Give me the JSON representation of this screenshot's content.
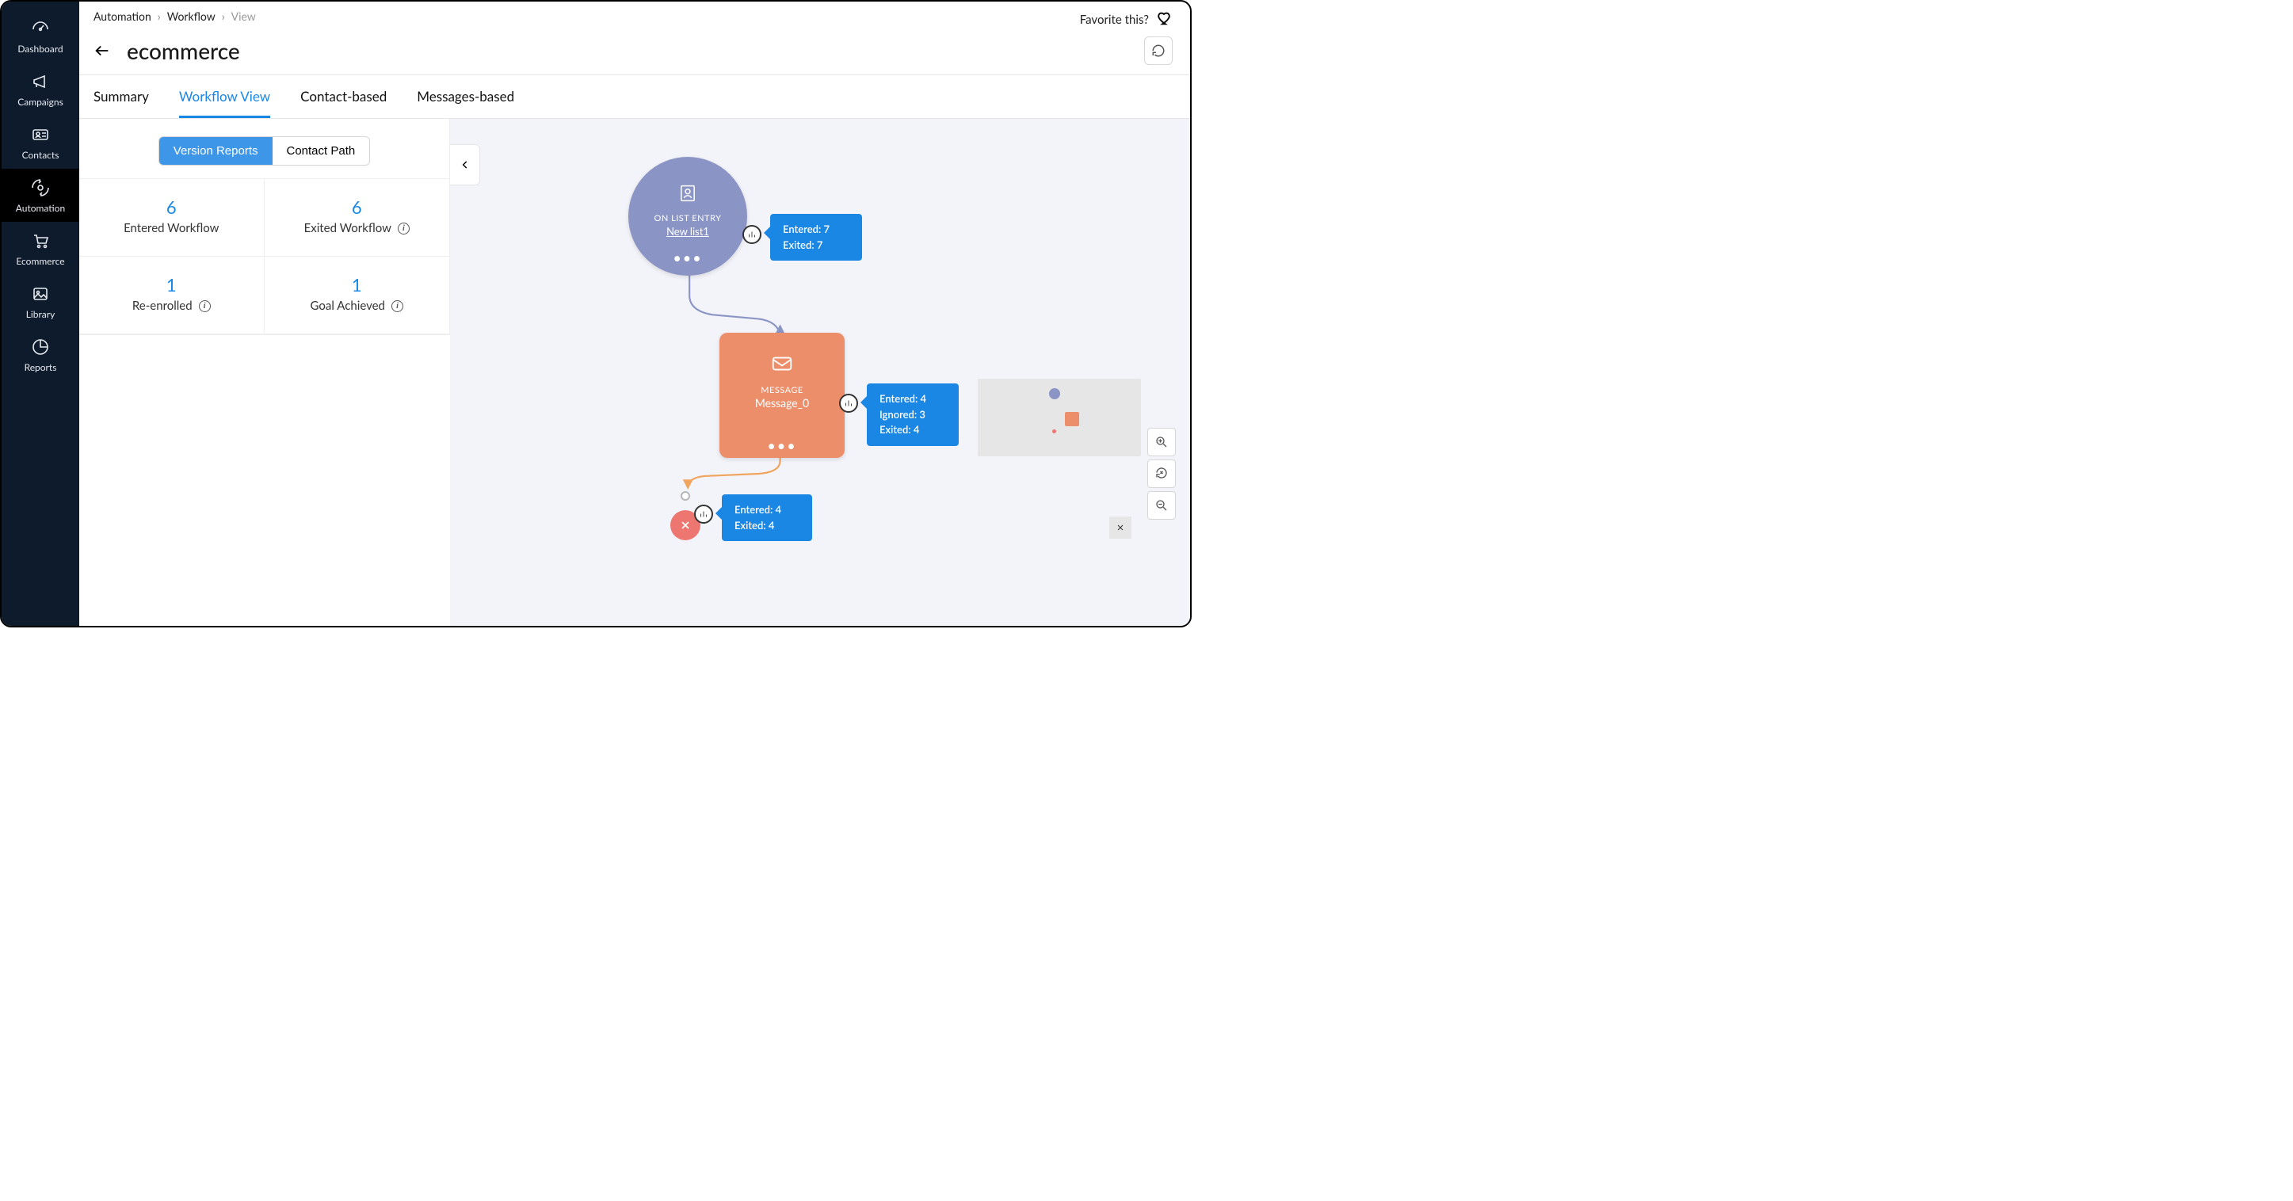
{
  "sidebar": {
    "items": [
      {
        "label": "Dashboard"
      },
      {
        "label": "Campaigns"
      },
      {
        "label": "Contacts"
      },
      {
        "label": "Automation"
      },
      {
        "label": "Ecommerce"
      },
      {
        "label": "Library"
      },
      {
        "label": "Reports"
      }
    ]
  },
  "breadcrumb": {
    "items": [
      "Automation",
      "Workflow",
      "View"
    ]
  },
  "header": {
    "favorite_label": "Favorite this?",
    "page_title": "ecommerce"
  },
  "tabs": [
    {
      "label": "Summary"
    },
    {
      "label": "Workflow View"
    },
    {
      "label": "Contact-based"
    },
    {
      "label": "Messages-based"
    }
  ],
  "panel": {
    "toggle": {
      "a": "Version Reports",
      "b": "Contact Path"
    },
    "stats": [
      {
        "value": "6",
        "label": "Entered Workflow",
        "info": false
      },
      {
        "value": "6",
        "label": "Exited Workflow",
        "info": true
      },
      {
        "value": "1",
        "label": "Re-enrolled",
        "info": true
      },
      {
        "value": "1",
        "label": "Goal Achieved",
        "info": true
      }
    ]
  },
  "flow": {
    "trigger": {
      "type_label": "ON LIST ENTRY",
      "name": "New list1",
      "stats": {
        "entered": "Entered: 7",
        "exited": "Exited: 7"
      }
    },
    "message": {
      "type_label": "MESSAGE",
      "name": "Message_0",
      "stats": {
        "entered": "Entered: 4",
        "ignored": "Ignored: 3",
        "exited": "Exited: 4"
      }
    },
    "end": {
      "stats": {
        "entered": "Entered: 4",
        "exited": "Exited: 4"
      }
    }
  }
}
